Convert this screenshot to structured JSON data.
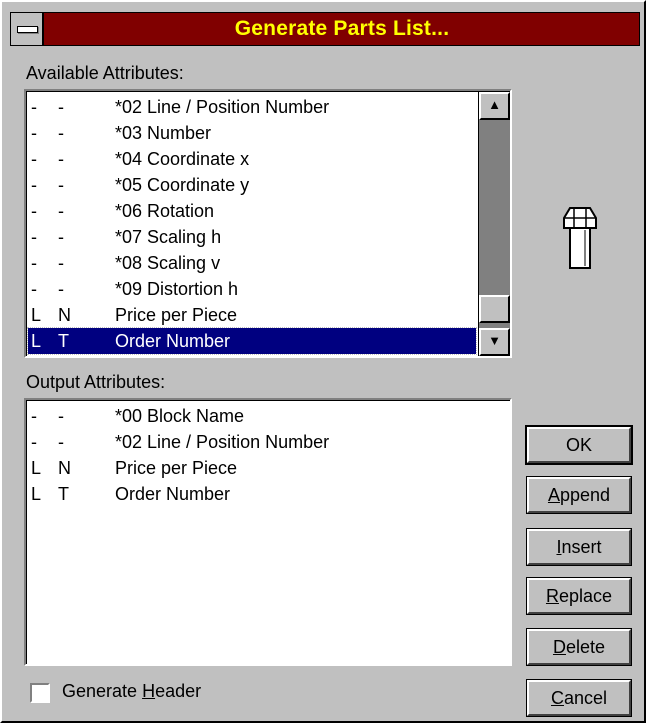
{
  "window": {
    "title": "Generate Parts List..."
  },
  "available": {
    "label": "Available Attributes:",
    "rows": [
      {
        "a": "-",
        "b": "-",
        "name": "*02 Line / Position Number"
      },
      {
        "a": "-",
        "b": "-",
        "name": "*03 Number"
      },
      {
        "a": "-",
        "b": "-",
        "name": "*04 Coordinate x"
      },
      {
        "a": "-",
        "b": "-",
        "name": "*05 Coordinate y"
      },
      {
        "a": "-",
        "b": "-",
        "name": "*06 Rotation"
      },
      {
        "a": "-",
        "b": "-",
        "name": "*07 Scaling h"
      },
      {
        "a": "-",
        "b": "-",
        "name": "*08 Scaling v"
      },
      {
        "a": "-",
        "b": "-",
        "name": "*09 Distortion h"
      },
      {
        "a": "L",
        "b": "N",
        "name": "Price per Piece"
      },
      {
        "a": "L",
        "b": "T",
        "name": "Order Number"
      }
    ],
    "selected_index": 9
  },
  "output": {
    "label": "Output Attributes:",
    "rows": [
      {
        "a": "-",
        "b": "-",
        "name": "*00 Block Name"
      },
      {
        "a": "-",
        "b": "-",
        "name": "*02 Line / Position Number"
      },
      {
        "a": "L",
        "b": "N",
        "name": "Price per Piece"
      },
      {
        "a": "L",
        "b": "T",
        "name": "Order Number"
      }
    ]
  },
  "buttons": {
    "ok": "OK",
    "append": {
      "u": "A",
      "rest": "ppend"
    },
    "insert": {
      "u": "I",
      "rest": "nsert"
    },
    "replace": {
      "u": "R",
      "rest": "eplace"
    },
    "delete": {
      "u": "D",
      "rest": "elete"
    },
    "cancel": {
      "u": "C",
      "rest": "ancel"
    }
  },
  "generate_header": {
    "pre": "Generate ",
    "u": "H",
    "rest": "eader",
    "checked": false
  },
  "icons": {
    "part_icon": "bolt-icon",
    "scroll_up": "up-arrow-icon",
    "scroll_down": "down-arrow-icon"
  },
  "colors": {
    "title_bg": "#800000",
    "title_fg": "#ffff00",
    "selection": "#000080",
    "face": "#c0c0c0"
  }
}
